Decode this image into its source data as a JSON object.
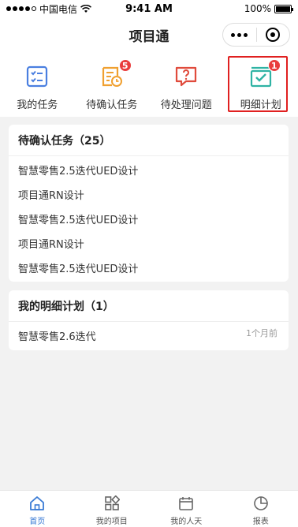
{
  "status_bar": {
    "carrier": "中国电信",
    "time": "9:41 AM",
    "battery": "100%"
  },
  "nav": {
    "title": "项目通"
  },
  "quick_menu": [
    {
      "label": "我的任务",
      "icon": "task-list-icon",
      "color": "#4a7fe0",
      "badge": ""
    },
    {
      "label": "待确认任务",
      "icon": "confirm-doc-icon",
      "color": "#f0a030",
      "badge": "5"
    },
    {
      "label": "待处理问题",
      "icon": "question-chat-icon",
      "color": "#e04b3c",
      "badge": ""
    },
    {
      "label": "明细计划",
      "icon": "check-board-icon",
      "color": "#2fb3a4",
      "badge": "1"
    }
  ],
  "pending_tasks": {
    "header": "待确认任务（25）",
    "items": [
      "智慧零售2.5迭代UED设计",
      "项目通RN设计",
      "智慧零售2.5迭代UED设计",
      "项目通RN设计",
      "智慧零售2.5迭代UED设计"
    ]
  },
  "my_plans": {
    "header": "我的明细计划（1）",
    "items": [
      {
        "title": "智慧零售2.6迭代",
        "time": "1个月前"
      }
    ]
  },
  "tab_bar": [
    {
      "label": "首页",
      "icon": "home-icon",
      "active": true
    },
    {
      "label": "我的项目",
      "icon": "grid-icon",
      "active": false
    },
    {
      "label": "我的人天",
      "icon": "calendar-icon",
      "active": false
    },
    {
      "label": "报表",
      "icon": "pie-chart-icon",
      "active": false
    }
  ],
  "colors": {
    "accent": "#3a7bd5",
    "badge": "#e93d3d",
    "highlight": "#e02020"
  }
}
